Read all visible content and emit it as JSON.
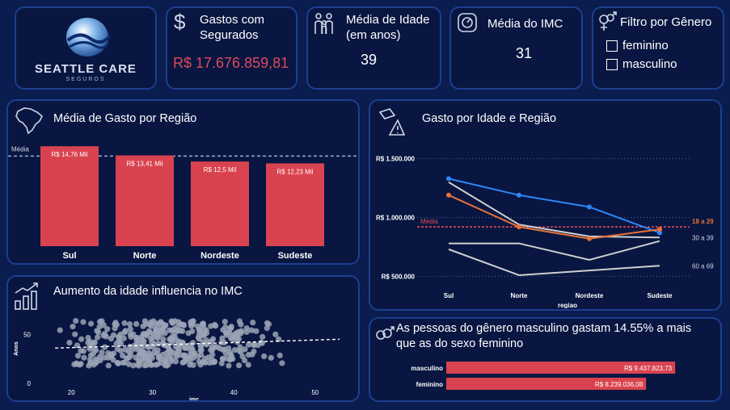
{
  "logo": {
    "name": "SEATTLE CARE",
    "sub": "SEGUROS"
  },
  "kpis": {
    "gastos": {
      "title_l1": "Gastos com",
      "title_l2": "Segurados",
      "value": "R$ 17.676.859,81",
      "value_color": "#e0495a"
    },
    "idade": {
      "title_l1": "Média de Idade",
      "title_l2": "(em anos)",
      "value": "39"
    },
    "imc": {
      "title": "Média do IMC",
      "value": "31"
    }
  },
  "filter": {
    "title": "Filtro por Gênero",
    "options": [
      "feminino",
      "masculino"
    ]
  },
  "icons": {
    "gastos": "dollar-icon",
    "idade": "family-icon",
    "imc": "scale-icon",
    "filter": "gender-icon",
    "regiao": "brazil-map-icon",
    "idade_regiao": "money-alert-icon",
    "imc_chart": "growth-bars-icon",
    "genero": "gender-icon"
  },
  "colors": {
    "bar": "#d9434f",
    "blue": "#2f86f6",
    "orange": "#e8733a",
    "grey": "#cfcfcf",
    "media_line": "#e0495a"
  },
  "charts": {
    "regiao": {
      "title": "Média de Gasto por Região",
      "media_label": "Média"
    },
    "idade_regiao": {
      "title": "Gasto por Idade e Região",
      "xlabel": "regiao",
      "media_label": "Média"
    },
    "imc": {
      "title": "Aumento da idade influencia no IMC",
      "xlabel": "imc",
      "ylabel": "Anos"
    },
    "genero": {
      "title_l1": "As pessoas do gênero masculino gastam 14.55% a mais",
      "title_l2": "que as do sexo feminino"
    }
  },
  "chart_data": [
    {
      "type": "bar",
      "title": "Média de Gasto por Região",
      "categories": [
        "Sul",
        "Norte",
        "Nordeste",
        "Sudeste"
      ],
      "values": [
        14.76,
        13.41,
        12.5,
        12.23
      ],
      "data_labels": [
        "R$ 14,76 Mil",
        "R$ 13,41 Mil",
        "R$ 12,5 Mil",
        "R$ 12,23 Mil"
      ],
      "average": 13.31,
      "ylim": [
        0,
        15.5
      ]
    },
    {
      "type": "line",
      "title": "Gasto por Idade e Região",
      "categories": [
        "Sul",
        "Norte",
        "Nordeste",
        "Sudeste"
      ],
      "xlabel": "regiao",
      "y_ticks": [
        "R$ 1.500.000",
        "R$ 1.000.000",
        "R$ 500.000"
      ],
      "y_tick_values": [
        1500000,
        1000000,
        500000
      ],
      "ylim": [
        400000,
        1600000
      ],
      "average": 920000,
      "series": [
        {
          "name": "",
          "color": "#2f86f6",
          "values": [
            1330000,
            1190000,
            1090000,
            870000
          ],
          "markers": true
        },
        {
          "name": "18 a 29",
          "color": "#e8733a",
          "values": [
            1190000,
            920000,
            820000,
            900000
          ],
          "markers": true
        },
        {
          "name": "30 a 39",
          "color": "#cfcfcf",
          "values": [
            1300000,
            940000,
            840000,
            830000
          ],
          "markers": false
        },
        {
          "name": "",
          "color": "#cfcfcf",
          "values": [
            780000,
            780000,
            640000,
            800000
          ],
          "markers": false
        },
        {
          "name": "60 a 69",
          "color": "#cfcfcf",
          "values": [
            730000,
            510000,
            550000,
            590000
          ],
          "markers": false
        }
      ]
    },
    {
      "type": "scatter",
      "title": "Aumento da idade influencia no IMC",
      "xlabel": "imc",
      "ylabel": "Anos",
      "x_ticks": [
        20,
        30,
        40,
        50
      ],
      "y_ticks": [
        0,
        50
      ],
      "xlim": [
        16,
        54
      ],
      "ylim": [
        0,
        70
      ],
      "trend": [
        [
          18,
          36
        ],
        [
          53,
          45
        ]
      ],
      "point_color": "#9aa3b5"
    },
    {
      "type": "bar",
      "orientation": "horizontal",
      "title": "As pessoas do gênero masculino gastam 14.55% a mais que as do sexo feminino",
      "categories": [
        "masculino",
        "feminino"
      ],
      "values": [
        9437823.73,
        8239036.08
      ],
      "data_labels": [
        "R$ 9.437.823,73",
        "R$ 8.239.036,08"
      ],
      "xlim": [
        0,
        10000000
      ]
    }
  ]
}
